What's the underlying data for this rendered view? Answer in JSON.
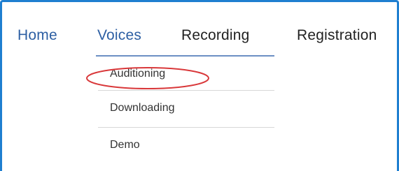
{
  "nav": {
    "items": [
      {
        "label": "Home"
      },
      {
        "label": "Voices"
      },
      {
        "label": "Recording"
      },
      {
        "label": "Registration"
      }
    ],
    "active": "Voices"
  },
  "dropdown": {
    "items": [
      {
        "label": "Auditioning"
      },
      {
        "label": "Downloading"
      },
      {
        "label": "Demo"
      }
    ],
    "highlighted": "Auditioning"
  },
  "colors": {
    "frame_border": "#1f7fd0",
    "nav_link": "#2d5fa3",
    "nav_text": "#222222",
    "highlight": "#d9383a"
  }
}
